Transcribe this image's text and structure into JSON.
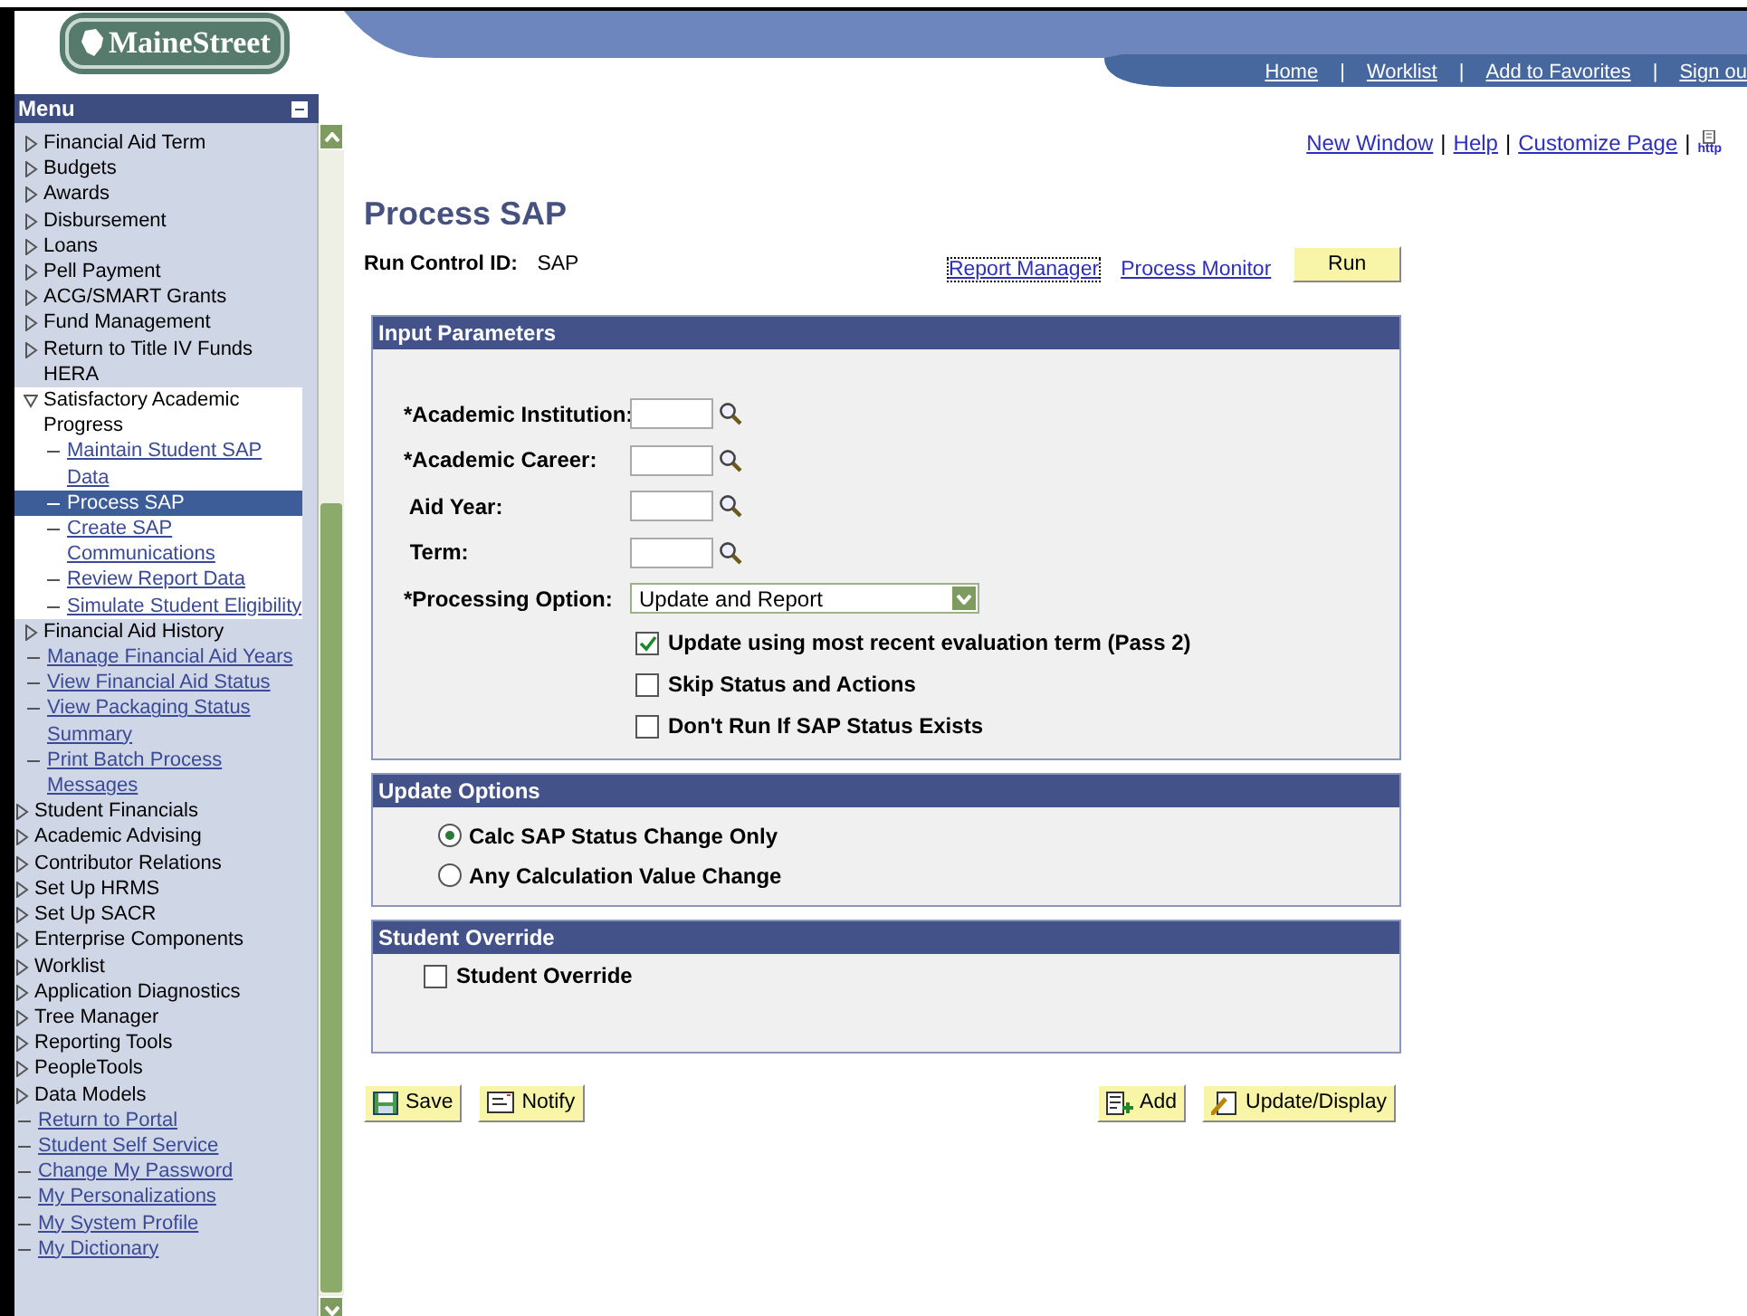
{
  "logo": {
    "text": "MaineStreet"
  },
  "header_links": [
    {
      "kind": "link",
      "label": "Home"
    },
    {
      "kind": "separator",
      "label": "|"
    },
    {
      "kind": "link",
      "label": "Worklist"
    },
    {
      "kind": "separator",
      "label": "|"
    },
    {
      "kind": "link",
      "label": "Add to Favorites"
    },
    {
      "kind": "separator",
      "label": "|"
    },
    {
      "kind": "link",
      "label": "Sign ou"
    }
  ],
  "menu": {
    "title": "Menu",
    "nested_items": [
      {
        "kind": "folder",
        "label": "Financial Aid Term",
        "expanded": false,
        "selected": false
      },
      {
        "kind": "folder",
        "label": "Budgets",
        "expanded": false,
        "selected": false
      },
      {
        "kind": "folder",
        "label": "Awards",
        "expanded": false,
        "selected": false
      },
      {
        "kind": "folder",
        "label": "Disbursement",
        "expanded": false,
        "selected": false
      },
      {
        "kind": "folder",
        "label": "Loans",
        "expanded": false,
        "selected": false
      },
      {
        "kind": "folder",
        "label": "Pell Payment",
        "expanded": false,
        "selected": false
      },
      {
        "kind": "folder",
        "label": "ACG/SMART Grants",
        "expanded": false,
        "selected": false
      },
      {
        "kind": "folder",
        "label": "Fund Management",
        "expanded": false,
        "selected": false
      },
      {
        "kind": "folder",
        "label": "Return to Title IV Funds HERA",
        "expanded": false,
        "selected": false
      },
      {
        "kind": "folder",
        "label": "Satisfactory Academic Progress",
        "expanded": true,
        "selected": false,
        "children": [
          {
            "kind": "link",
            "label": "Maintain Student SAP Data",
            "selected": false
          },
          {
            "kind": "link",
            "label": "Process SAP",
            "selected": true
          },
          {
            "kind": "link",
            "label": "Create SAP Communications",
            "selected": false
          },
          {
            "kind": "link",
            "label": "Review Report Data",
            "selected": false
          },
          {
            "kind": "link",
            "label": "Simulate Student Eligibility",
            "selected": false
          }
        ]
      },
      {
        "kind": "folder",
        "label": "Financial Aid History",
        "expanded": false,
        "selected": false
      },
      {
        "kind": "link",
        "label": "Manage Financial Aid Years",
        "selected": false
      },
      {
        "kind": "link",
        "label": "View Financial Aid Status",
        "selected": false
      },
      {
        "kind": "link",
        "label": "View Packaging Status Summary",
        "selected": false
      },
      {
        "kind": "link",
        "label": "Print Batch Process Messages",
        "selected": false
      }
    ],
    "items": [
      {
        "kind": "folder",
        "label": "Student Financials",
        "expanded": false,
        "selected": false
      },
      {
        "kind": "folder",
        "label": "Academic Advising",
        "expanded": false,
        "selected": false
      },
      {
        "kind": "folder",
        "label": "Contributor Relations",
        "expanded": false,
        "selected": false
      },
      {
        "kind": "folder",
        "label": "Set Up HRMS",
        "expanded": false,
        "selected": false
      },
      {
        "kind": "folder",
        "label": "Set Up SACR",
        "expanded": false,
        "selected": false
      },
      {
        "kind": "folder",
        "label": "Enterprise Components",
        "expanded": false,
        "selected": false
      },
      {
        "kind": "folder",
        "label": "Worklist",
        "expanded": false,
        "selected": false
      },
      {
        "kind": "folder",
        "label": "Application Diagnostics",
        "expanded": false,
        "selected": false
      },
      {
        "kind": "folder",
        "label": "Tree Manager",
        "expanded": false,
        "selected": false
      },
      {
        "kind": "folder",
        "label": "Reporting Tools",
        "expanded": false,
        "selected": false
      },
      {
        "kind": "folder",
        "label": "PeopleTools",
        "expanded": false,
        "selected": false
      },
      {
        "kind": "folder",
        "label": "Data Models",
        "expanded": false,
        "selected": false
      },
      {
        "kind": "link",
        "label": "Return to Portal",
        "selected": false
      },
      {
        "kind": "link",
        "label": "Student Self Service",
        "selected": false
      },
      {
        "kind": "link",
        "label": "Change My Password",
        "selected": false
      },
      {
        "kind": "link",
        "label": "My Personalizations",
        "selected": false
      },
      {
        "kind": "link",
        "label": "My System Profile",
        "selected": false
      },
      {
        "kind": "link",
        "label": "My Dictionary",
        "selected": false
      }
    ]
  },
  "page_links": [
    {
      "kind": "link",
      "label": "New Window"
    },
    {
      "kind": "separator",
      "label": "|"
    },
    {
      "kind": "link",
      "label": "Help"
    },
    {
      "kind": "separator",
      "label": "|"
    },
    {
      "kind": "link",
      "label": "Customize Page"
    },
    {
      "kind": "separator",
      "label": "|"
    },
    {
      "kind": "icon",
      "label": "http"
    }
  ],
  "page_title": "Process SAP",
  "run_control": {
    "label": "Run Control ID:",
    "value": "SAP",
    "links": [
      "Report Manager",
      "Process Monitor"
    ],
    "run_button": "Run"
  },
  "input_parameters": {
    "title": "Input Parameters",
    "fields": [
      {
        "kind": "lookup",
        "label": "*Academic Institution:"
      },
      {
        "kind": "lookup",
        "label": "*Academic Career:"
      },
      {
        "kind": "lookup",
        "label": " Aid Year:"
      },
      {
        "kind": "lookup",
        "label": " Term:"
      },
      {
        "kind": "dropdown",
        "label": "*Processing Option:",
        "value": "Update and Report"
      }
    ],
    "checkboxes": [
      {
        "label": "Update using most recent evaluation term (Pass 2)",
        "checked": true
      },
      {
        "label": "Skip Status and Actions",
        "checked": false
      },
      {
        "label": "Don't Run If SAP Status Exists",
        "checked": false
      }
    ]
  },
  "update_options": {
    "title": "Update Options",
    "radios": [
      {
        "label": "Calc SAP Status Change Only",
        "selected": true
      },
      {
        "label": "Any Calculation Value Change",
        "selected": false
      }
    ]
  },
  "student_override": {
    "title": "Student Override",
    "checkbox": {
      "label": "Student Override",
      "checked": false
    }
  },
  "buttons_left": [
    {
      "kind": "save",
      "label": "Save"
    },
    {
      "kind": "notify",
      "label": "Notify"
    }
  ],
  "buttons_right": [
    {
      "kind": "add",
      "label": "Add"
    },
    {
      "kind": "update",
      "label": "Update/Display"
    }
  ]
}
